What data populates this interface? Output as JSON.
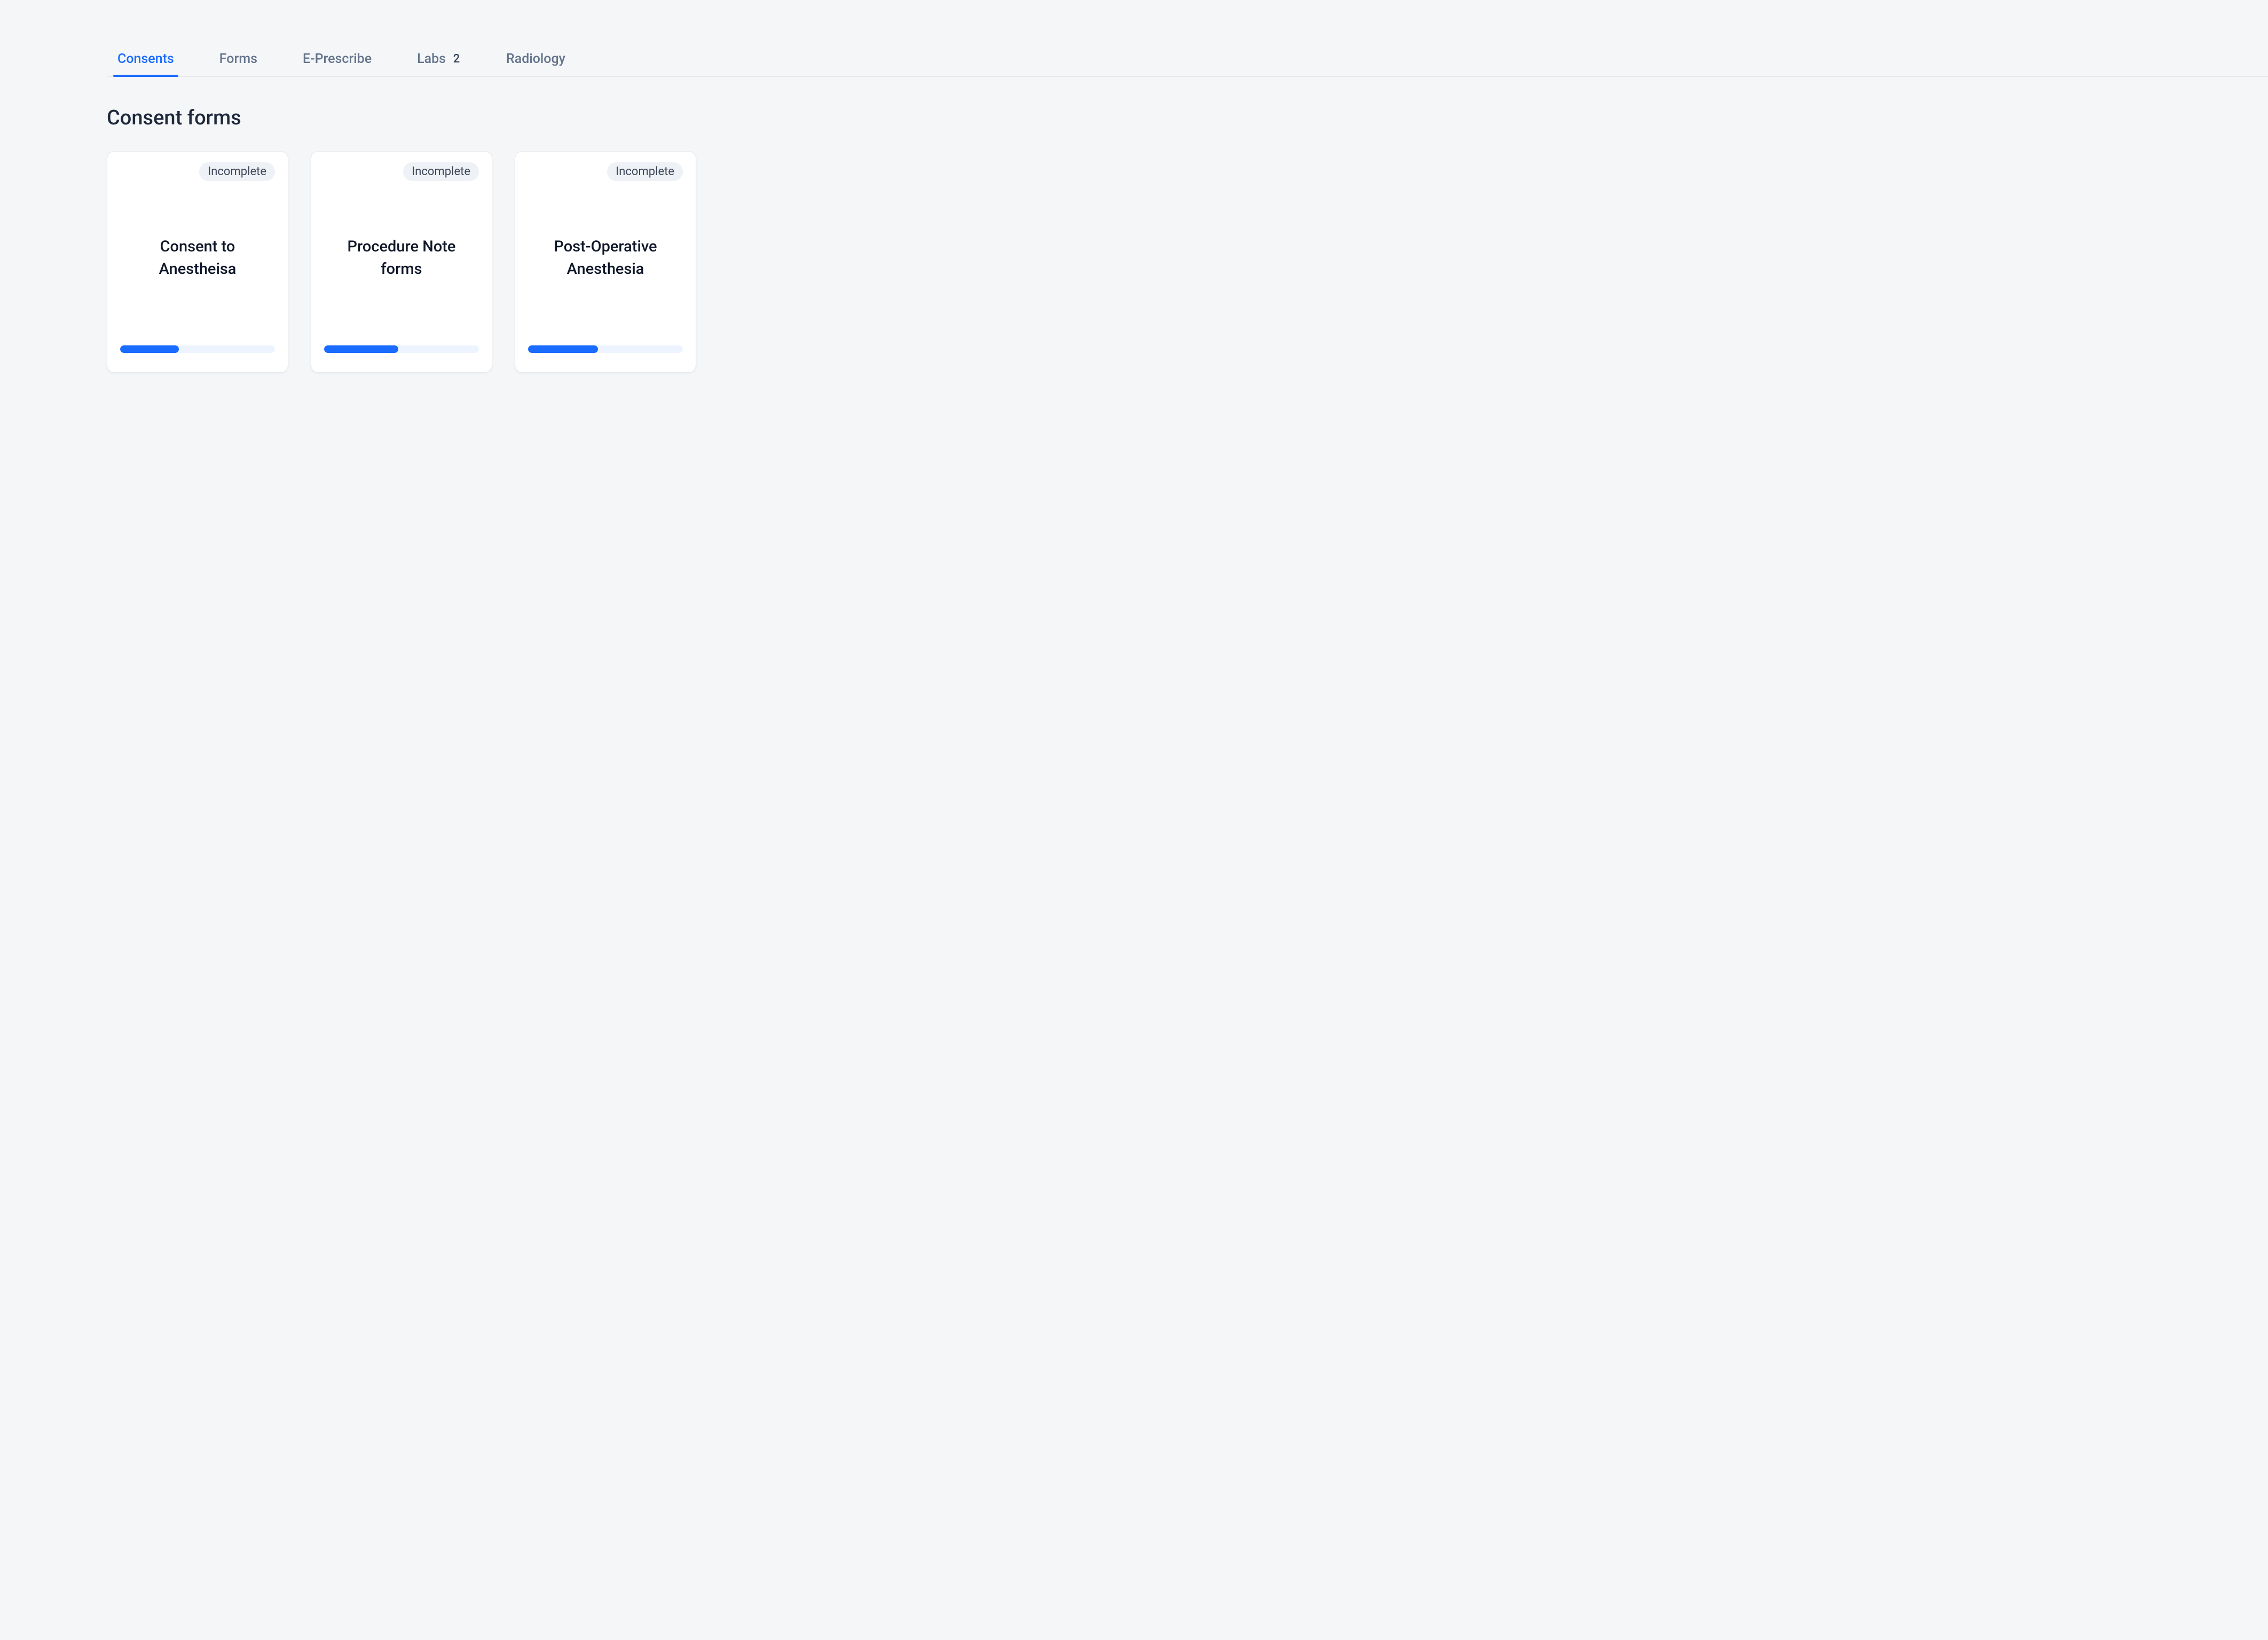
{
  "tabs": [
    {
      "label": "Consents",
      "active": true
    },
    {
      "label": "Forms",
      "active": false
    },
    {
      "label": "E-Prescribe",
      "active": false
    },
    {
      "label": "Labs",
      "active": false,
      "badge": "2"
    },
    {
      "label": "Radiology",
      "active": false
    }
  ],
  "section_title": "Consent forms",
  "cards": [
    {
      "status": "Incomplete",
      "title": "Consent to Anestheisa",
      "progress_percent": 38
    },
    {
      "status": "Incomplete",
      "title": "Procedure Note forms",
      "progress_percent": 48
    },
    {
      "status": "Incomplete",
      "title": "Post-Operative Anesthesia",
      "progress_percent": 45
    }
  ]
}
